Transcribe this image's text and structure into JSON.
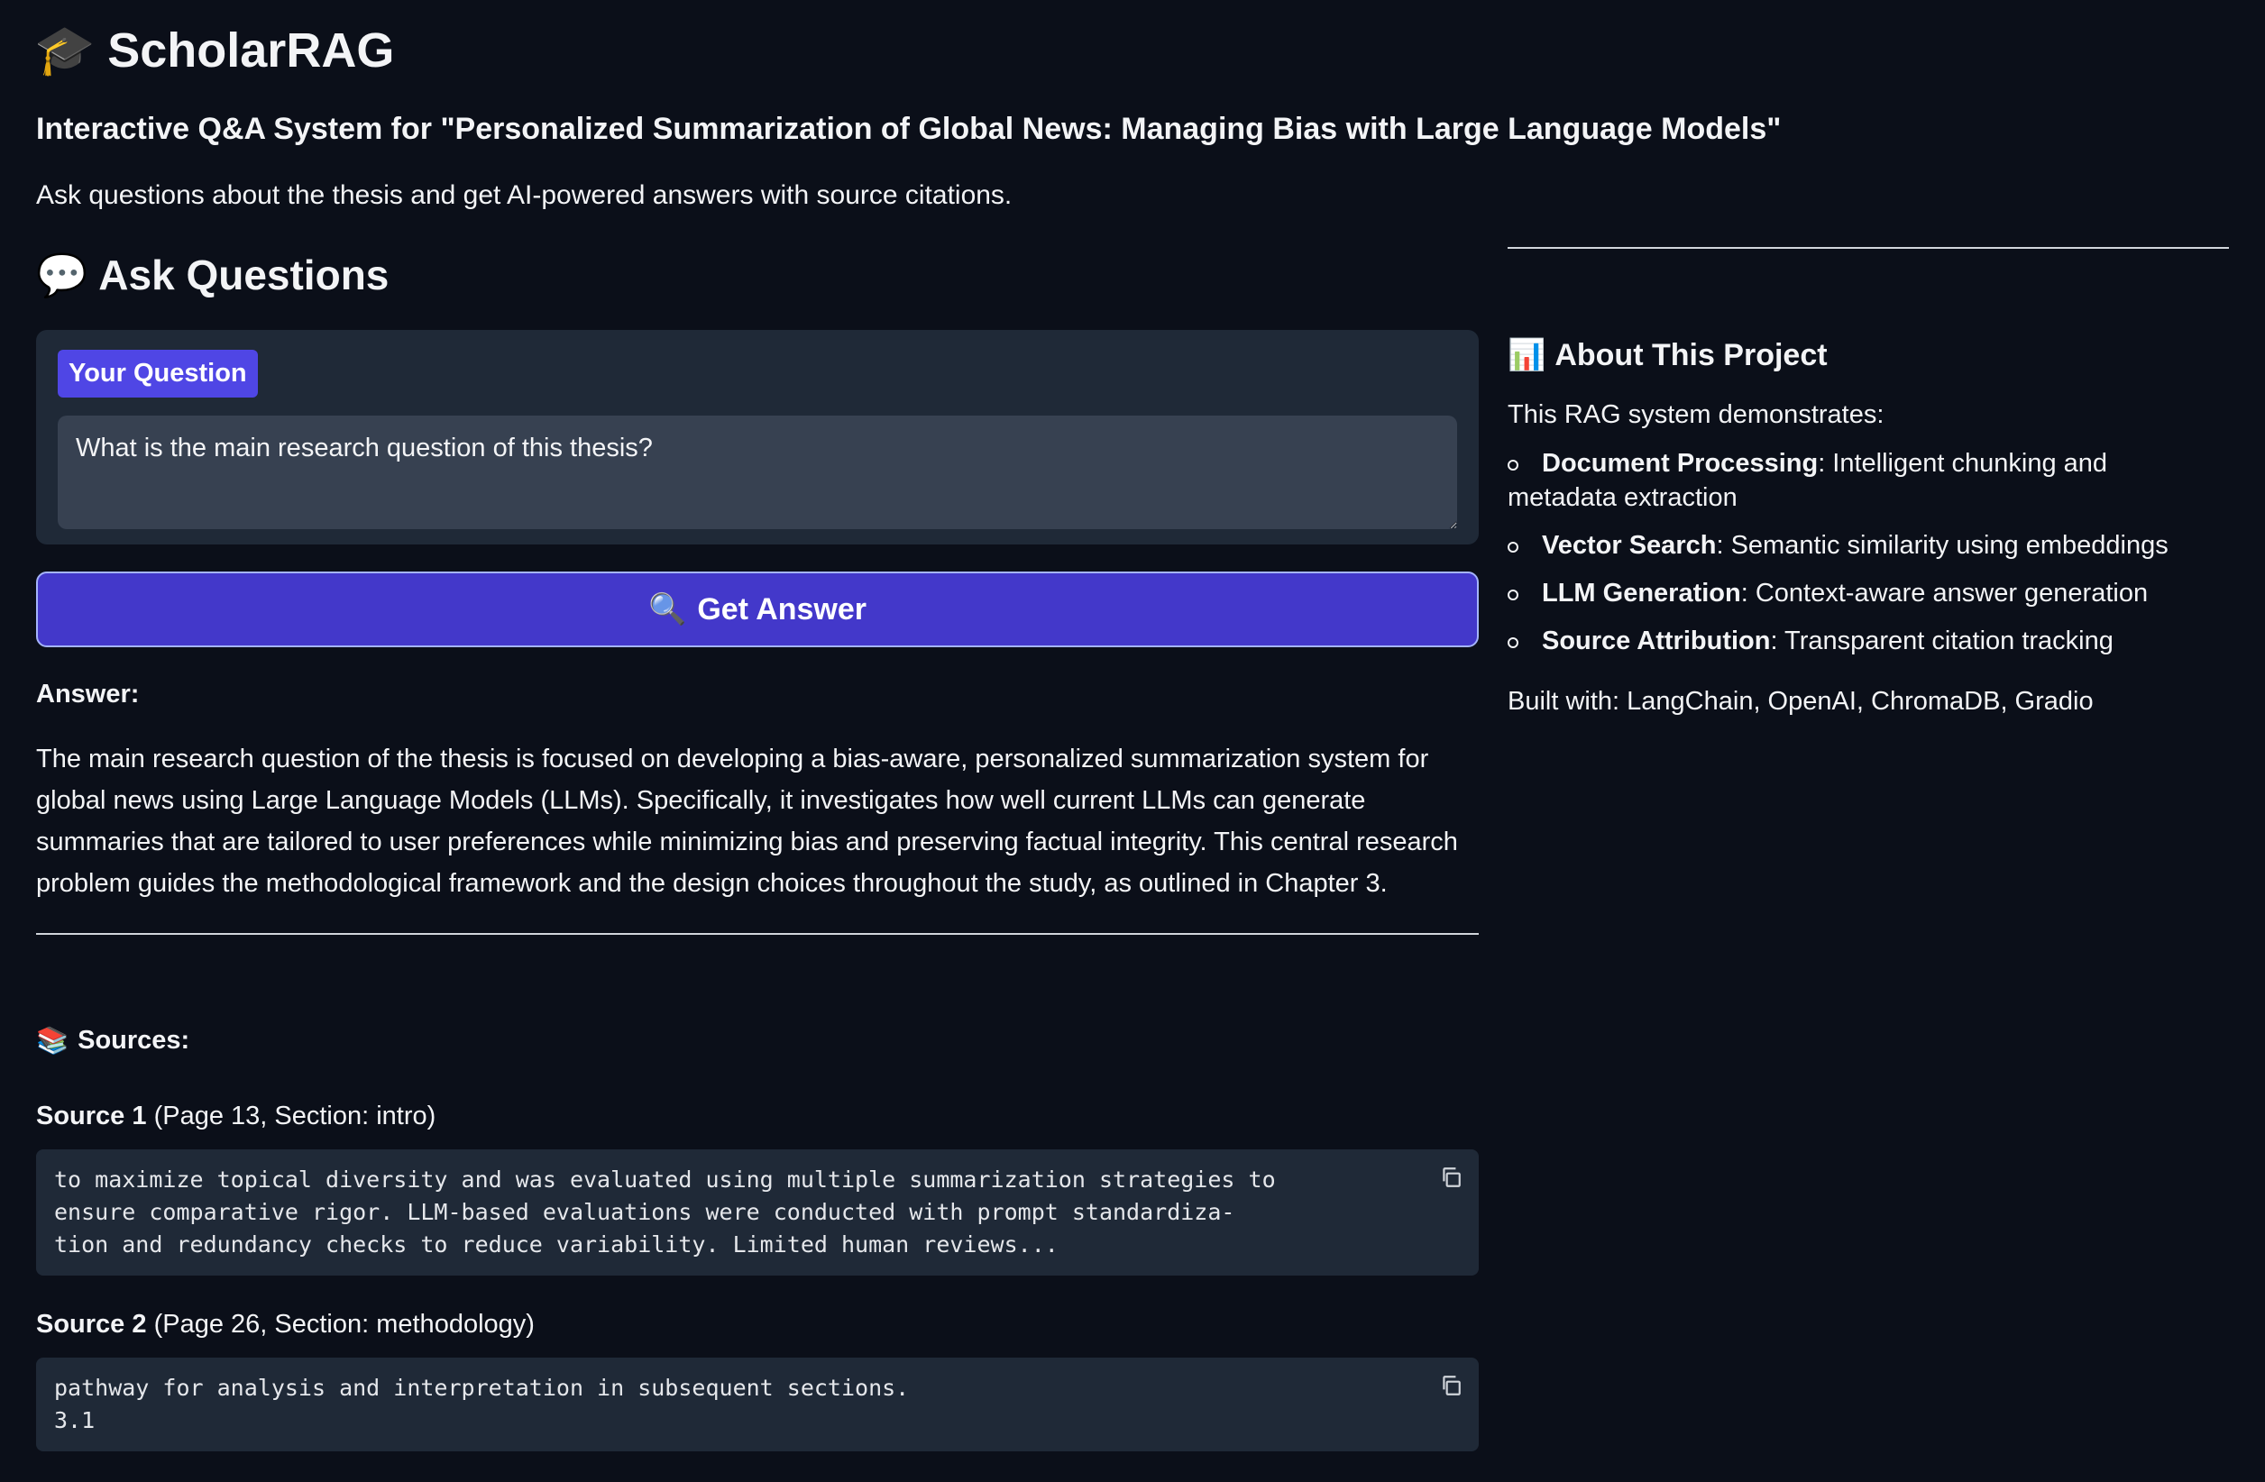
{
  "app": {
    "title": "ScholarRAG",
    "title_icon": "graduation-cap",
    "subtitle": "Interactive Q&A System for \"Personalized Summarization of Global News: Managing Bias with Large Language Models\"",
    "intro": "Ask questions about the thesis and get AI-powered answers with source citations."
  },
  "ask": {
    "heading": "Ask Questions",
    "heading_icon": "speech-bubble",
    "question_label": "Your Question",
    "question_value": "What is the main research question of this thesis?",
    "button_label": "Get Answer",
    "button_icon": "magnifier"
  },
  "answer": {
    "label": "Answer:",
    "text": "The main research question of the thesis is focused on developing a bias-aware, personalized summarization system for global news using Large Language Models (LLMs). Specifically, it investigates how well current LLMs can generate summaries that are tailored to user preferences while minimizing bias and preserving factual integrity. This central research problem guides the methodological framework and the design choices throughout the study, as outlined in Chapter 3."
  },
  "sources": {
    "heading": "Sources:",
    "heading_icon": "books",
    "items": [
      {
        "label": "Source 1",
        "meta": "(Page 13, Section: intro)",
        "excerpt": "to maximize topical diversity and was evaluated using multiple summarization strategies to\nensure comparative rigor. LLM-based evaluations were conducted with prompt standardiza-\ntion and redundancy checks to reduce variability. Limited human reviews..."
      },
      {
        "label": "Source 2",
        "meta": "(Page 26, Section: methodology)",
        "excerpt": "pathway for analysis and interpretation in subsequent sections.\n3.1"
      }
    ]
  },
  "about": {
    "heading": "About This Project",
    "heading_icon": "bar-chart",
    "intro": "This RAG system demonstrates:",
    "features": [
      {
        "name": "Document Processing",
        "desc": ": Intelligent chunking and",
        "desc2": "metadata extraction"
      },
      {
        "name": "Vector Search",
        "desc": ": Semantic similarity using embeddings",
        "desc2": ""
      },
      {
        "name": "LLM Generation",
        "desc": ": Context-aware answer generation",
        "desc2": ""
      },
      {
        "name": "Source Attribution",
        "desc": ": Transparent citation tracking",
        "desc2": ""
      }
    ],
    "built_with": "Built with: LangChain, OpenAI, ChromaDB, Gradio"
  },
  "colors": {
    "background": "#0b0f19",
    "panel": "#1f2937",
    "input": "#374151",
    "accent": "#4f46e5",
    "button": "#4338ca"
  }
}
